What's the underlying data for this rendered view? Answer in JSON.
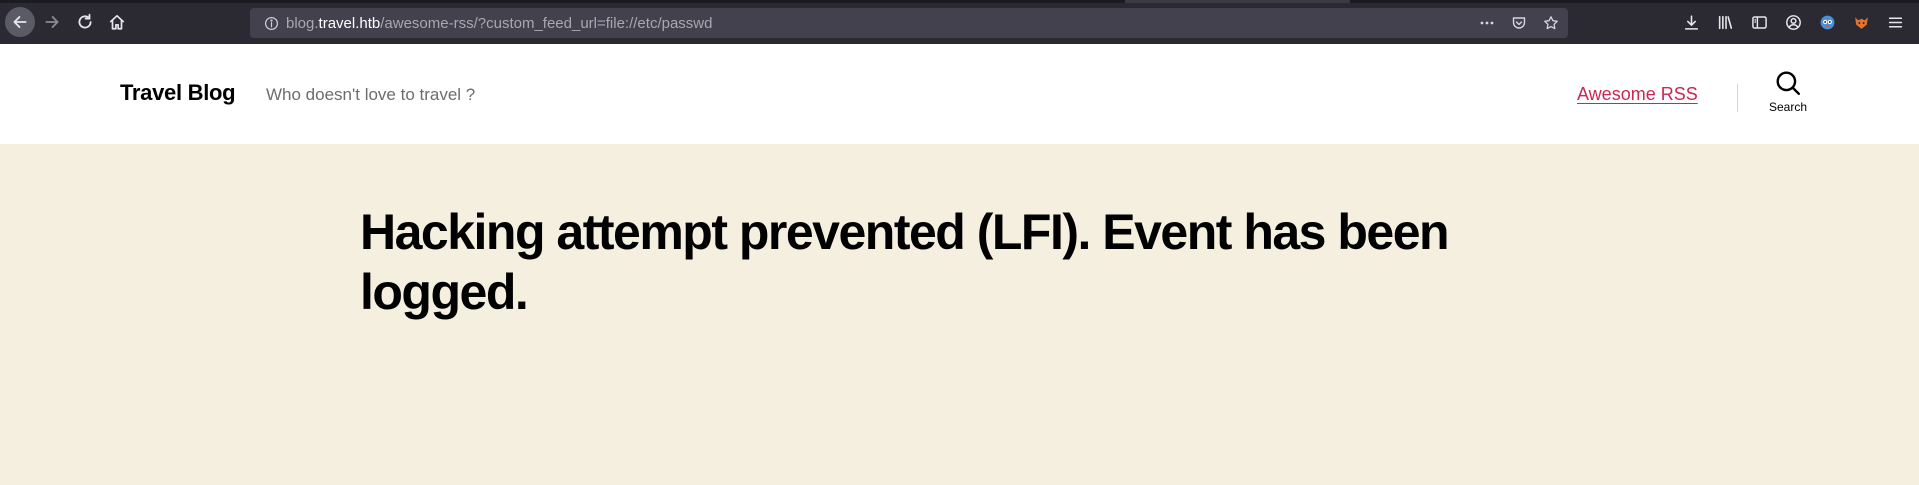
{
  "browser": {
    "url": {
      "prefix": "blog.",
      "domain": "travel.htb",
      "path": "/awesome-rss/?custom_feed_url=file://etc/passwd"
    }
  },
  "site": {
    "title": "Travel Blog",
    "description": "Who doesn't love to travel ?",
    "nav": {
      "awesome_rss": "Awesome RSS"
    },
    "search_label": "Search"
  },
  "main": {
    "heading": "Hacking attempt prevented (LFI). Event has been logged."
  },
  "colors": {
    "accent": "#cd2653",
    "background": "#f5efe0",
    "toolbar": "#2b2a33"
  }
}
